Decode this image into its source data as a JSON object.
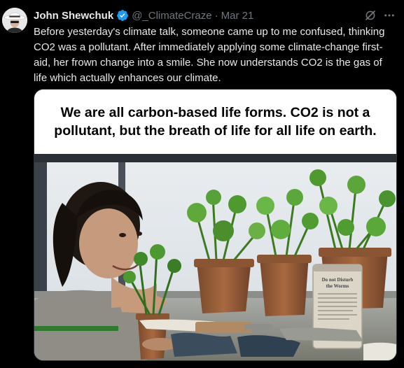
{
  "post": {
    "display_name": "John Shewchuk",
    "handle": "@_ClimateCraze",
    "separator": "·",
    "date": "Mar 21",
    "verified": true,
    "text": "Before yesterday's climate talk, someone came up to me confused, thinking CO2 was a pollutant.  After immediately applying some climate-change first-aid, her frown change into a smile.  She now understands CO2 is the gas of life which actually enhances our climate."
  },
  "media": {
    "caption": "We are all carbon-based life forms.  CO2 is not a pollutant, but the breath of life for all life on earth.",
    "can_label_line1": "Do not Disturb",
    "can_label_line2": "the Worms"
  },
  "icons": {
    "avatar": "avatar-cowboy-hat",
    "verified": "verified-badge-icon",
    "grok": "grok-icon",
    "more": "more-icon"
  },
  "colors": {
    "background": "#000000",
    "text_primary": "#e7e9ea",
    "text_secondary": "#71767b",
    "verified_blue": "#1d9bf0"
  }
}
